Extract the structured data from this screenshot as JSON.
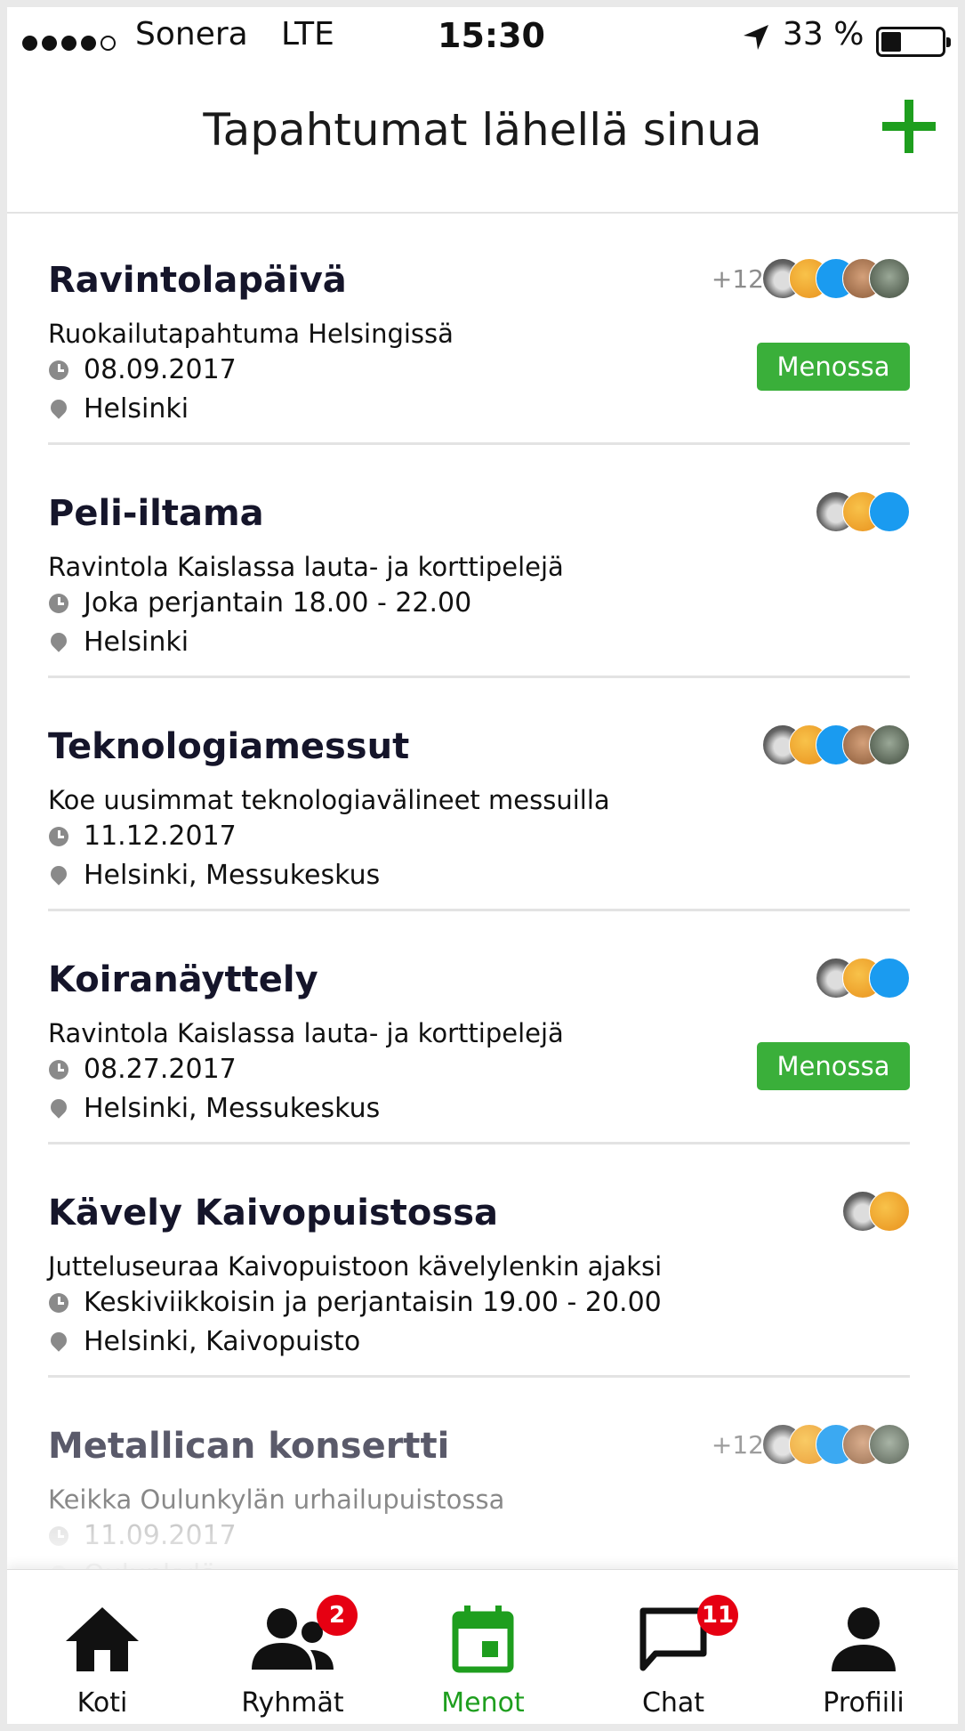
{
  "status_bar": {
    "carrier": "Sonera",
    "network": "LTE",
    "time": "15:30",
    "battery": "33 %",
    "battery_level": 0.33
  },
  "header": {
    "title": "Tapahtumat lähellä sinua",
    "add_icon": "plus-icon"
  },
  "events": [
    {
      "title": "Ravintolapäivä",
      "description": "Ruokailutapahtuma Helsingissä",
      "date": "08.09.2017",
      "place": "Helsinki",
      "extra": "+12",
      "status": "Menossa"
    },
    {
      "title": "Peli-iltama",
      "description": "Ravintola Kaislassa lauta- ja korttipelejä",
      "date": "Joka perjantain 18.00 - 22.00",
      "place": "Helsinki"
    },
    {
      "title": "Teknologiamessut",
      "description": "Koe uusimmat teknologiavälineet messuilla",
      "date": "11.12.2017",
      "place": "Helsinki, Messukeskus"
    },
    {
      "title": "Koiranäyttely",
      "description": "Ravintola Kaislassa lauta- ja korttipelejä",
      "date": "08.27.2017",
      "place": "Helsinki, Messukeskus",
      "status": "Menossa"
    },
    {
      "title": "Kävely Kaivopuistossa",
      "description": "Jutteluseuraa Kaivopuistoon kävelylenkin ajaksi",
      "date": "Keskiviikkoisin ja perjantaisin 19.00 - 20.00",
      "place": "Helsinki, Kaivopuisto"
    },
    {
      "title": "Metallican konsertti",
      "description": "Keikka Oulunkylän urhailupuistossa",
      "date": "11.09.2017",
      "place": "Oulunkylä",
      "extra": "+12"
    }
  ],
  "tabs": [
    {
      "label": "Koti",
      "icon": "home-icon"
    },
    {
      "label": "Ryhmät",
      "icon": "groups-icon",
      "badge": "2"
    },
    {
      "label": "Menot",
      "icon": "calendar-icon",
      "active": true
    },
    {
      "label": "Chat",
      "icon": "chat-icon",
      "badge": "11"
    },
    {
      "label": "Profiili",
      "icon": "profile-icon"
    }
  ],
  "colors": {
    "accent": "#1e9e1e",
    "going": "#3aaf3a",
    "badge": "#e60012"
  }
}
